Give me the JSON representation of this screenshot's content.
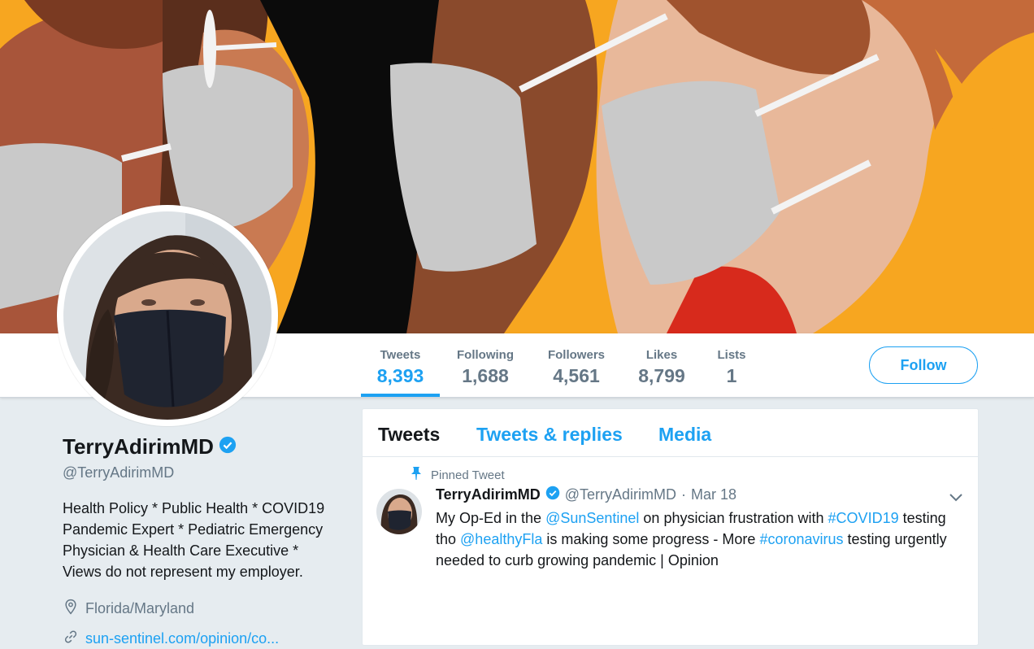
{
  "stats": [
    {
      "label": "Tweets",
      "value": "8,393",
      "active": true
    },
    {
      "label": "Following",
      "value": "1,688",
      "active": false
    },
    {
      "label": "Followers",
      "value": "4,561",
      "active": false
    },
    {
      "label": "Likes",
      "value": "8,799",
      "active": false
    },
    {
      "label": "Lists",
      "value": "1",
      "active": false
    }
  ],
  "follow_label": "Follow",
  "profile": {
    "name": "TerryAdirimMD",
    "handle": "@TerryAdirimMD",
    "bio_lines": [
      "Health Policy * Public Health * COVID19",
      "Pandemic Expert * Pediatric Emergency",
      "Physician & Health Care Executive *",
      "Views do not represent my employer."
    ],
    "location": "Florida/Maryland",
    "link": "sun-sentinel.com/opinion/co..."
  },
  "tabs": [
    {
      "label": "Tweets",
      "active": true
    },
    {
      "label": "Tweets & replies",
      "active": false
    },
    {
      "label": "Media",
      "active": false
    }
  ],
  "tweet": {
    "pinned_label": "Pinned Tweet",
    "name": "TerryAdirimMD",
    "handle": "@TerryAdirimMD",
    "dot": "·",
    "date": "Mar 18",
    "text": {
      "p1": "My Op-Ed in the ",
      "l1": "@SunSentinel",
      "p2": " on physician frustration with ",
      "l2": "#COVID19",
      "p3": " testing tho ",
      "l3": "@healthyFla",
      "p4": " is making some progress - More ",
      "l4": "#coronavirus",
      "p5": " testing urgently needed to curb growing pandemic | Opinion"
    }
  },
  "colors": {
    "accent": "#1da1f2",
    "verified": "#1da1f2",
    "muted": "#657786",
    "banner_orange": "#f7a620"
  },
  "icons": [
    "verified-badge-icon",
    "location-pin-icon",
    "link-icon",
    "pin-icon",
    "chevron-down-icon"
  ]
}
